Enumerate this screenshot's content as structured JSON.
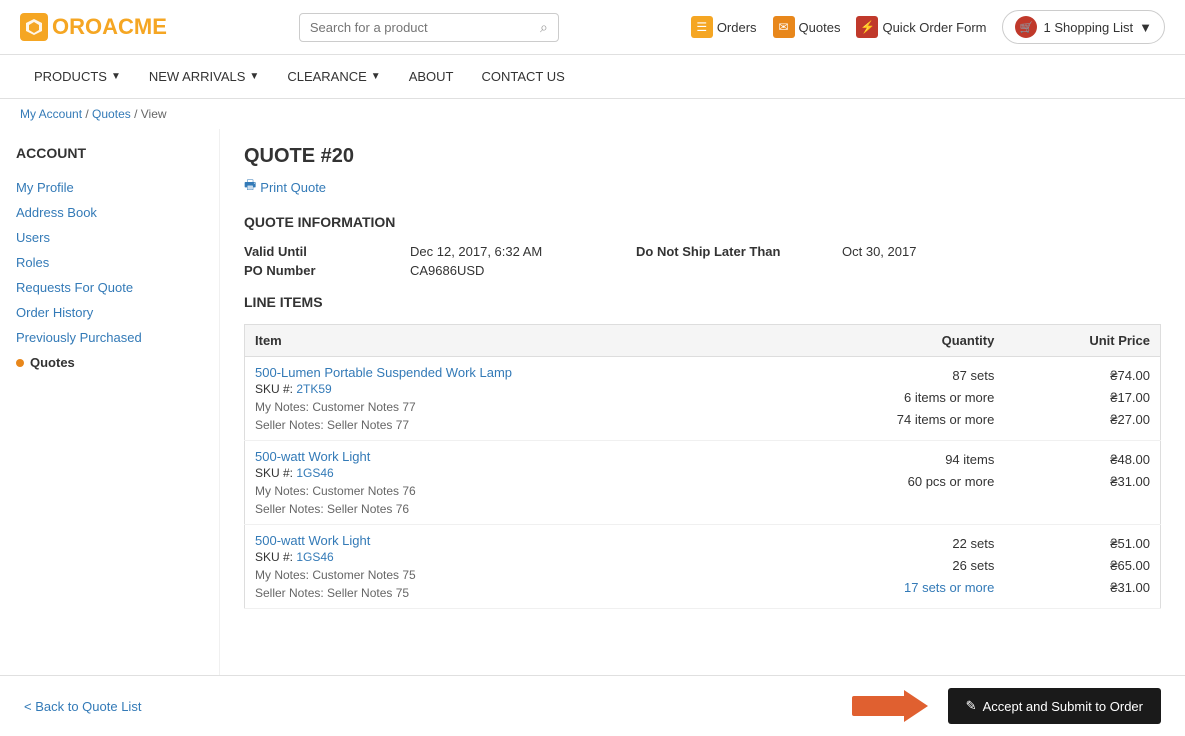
{
  "brand": {
    "logo_text_1": "ORO",
    "logo_text_2": "ACME"
  },
  "header": {
    "search_placeholder": "Search for a product",
    "actions": [
      {
        "icon": "orders-icon",
        "label": "Orders",
        "color": "orange"
      },
      {
        "icon": "quotes-icon",
        "label": "Quotes",
        "color": "dark-orange"
      },
      {
        "icon": "quick-order-icon",
        "label": "Quick Order Form",
        "color": "red"
      }
    ],
    "shopping_list": "1 Shopping List"
  },
  "nav": {
    "items": [
      {
        "label": "PRODUCTS",
        "has_dropdown": true
      },
      {
        "label": "NEW ARRIVALS",
        "has_dropdown": true
      },
      {
        "label": "CLEARANCE",
        "has_dropdown": true
      },
      {
        "label": "ABOUT",
        "has_dropdown": false
      },
      {
        "label": "CONTACT US",
        "has_dropdown": false
      }
    ]
  },
  "breadcrumb": {
    "parts": [
      "My Account",
      "Quotes",
      "View"
    ],
    "separator": " / "
  },
  "sidebar": {
    "title": "ACCOUNT",
    "items": [
      {
        "label": "My Profile",
        "active": false
      },
      {
        "label": "Address Book",
        "active": false
      },
      {
        "label": "Users",
        "active": false
      },
      {
        "label": "Roles",
        "active": false
      },
      {
        "label": "Requests For Quote",
        "active": false
      },
      {
        "label": "Order History",
        "active": false
      },
      {
        "label": "Previously Purchased",
        "active": false
      },
      {
        "label": "Quotes",
        "active": true
      }
    ]
  },
  "quote": {
    "title": "QUOTE #20",
    "print_label": "Print Quote",
    "info_section_title": "QUOTE INFORMATION",
    "valid_until_label": "Valid Until",
    "valid_until_value": "Dec 12, 2017, 6:32 AM",
    "do_not_ship_label": "Do Not Ship Later Than",
    "do_not_ship_value": "Oct 30, 2017",
    "po_number_label": "PO Number",
    "po_number_value": "CA9686USD",
    "line_items_title": "LINE ITEMS",
    "table_headers": {
      "item": "Item",
      "quantity": "Quantity",
      "unit_price": "Unit Price"
    },
    "line_items": [
      {
        "name": "500-Lumen Portable Suspended Work Lamp",
        "sku": "2TK59",
        "my_notes": "My Notes: Customer Notes 77",
        "seller_notes": "Seller Notes: Seller Notes 77",
        "quantities": [
          {
            "qty": "87 sets",
            "highlighted": false
          },
          {
            "qty": "6 items or more",
            "highlighted": false
          },
          {
            "qty": "74 items or more",
            "highlighted": false
          }
        ],
        "prices": [
          {
            "price": "₴74.00"
          },
          {
            "price": "₴17.00"
          },
          {
            "price": "₴27.00"
          }
        ]
      },
      {
        "name": "500-watt Work Light",
        "sku": "1GS46",
        "my_notes": "My Notes: Customer Notes 76",
        "seller_notes": "Seller Notes: Seller Notes 76",
        "quantities": [
          {
            "qty": "94 items",
            "highlighted": false
          },
          {
            "qty": "60 pcs or more",
            "highlighted": false
          }
        ],
        "prices": [
          {
            "price": "₴48.00"
          },
          {
            "price": "₴31.00"
          }
        ]
      },
      {
        "name": "500-watt Work Light",
        "sku": "1GS46",
        "my_notes": "My Notes: Customer Notes 75",
        "seller_notes": "Seller Notes: Seller Notes 75",
        "quantities": [
          {
            "qty": "22 sets",
            "highlighted": false
          },
          {
            "qty": "26 sets",
            "highlighted": false
          },
          {
            "qty": "17 sets or more",
            "highlighted": true
          }
        ],
        "prices": [
          {
            "price": "₴51.00"
          },
          {
            "price": "₴65.00"
          },
          {
            "price": "₴31.00"
          }
        ]
      }
    ]
  },
  "footer": {
    "back_link": "< Back to Quote List",
    "accept_btn": "Accept and Submit to Order"
  }
}
